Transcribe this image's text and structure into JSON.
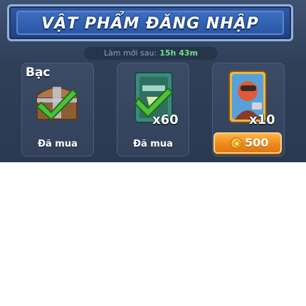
{
  "header": {
    "title": "VẬT PHẨM ĐĂNG NHẬP"
  },
  "refresh": {
    "label": "Làm mới sau:",
    "time": "15h 43m"
  },
  "items": [
    {
      "tier": "Bạc",
      "icon": "silver-chest-icon",
      "status": "Đã mua"
    },
    {
      "icon": "spell-book-icon",
      "quantity": "x60",
      "status": "Đã mua"
    },
    {
      "icon": "hero-card-icon",
      "quantity": "x10",
      "price": "500",
      "price_icon": "gold-coin-icon"
    }
  ],
  "colors": {
    "accent": "#f08a1a",
    "check": "#4cc23a",
    "title_bg": "#2a57a5",
    "refresh_time": "#6fe08a"
  }
}
